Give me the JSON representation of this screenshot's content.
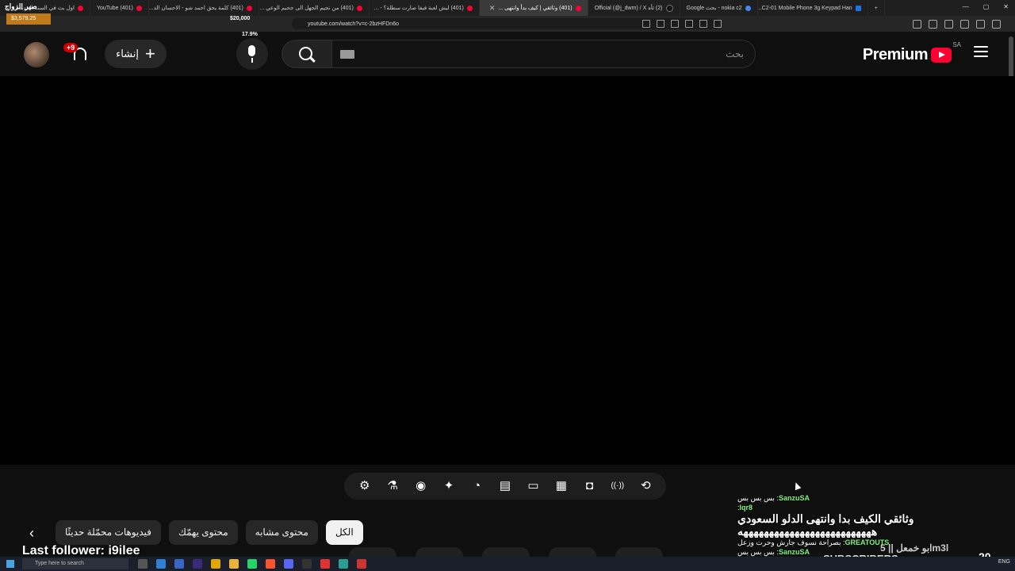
{
  "browser": {
    "tabs": [
      {
        "title": "اول بث في السنة الجديدة - ...",
        "active": false,
        "favicon": "youtube-favicon"
      },
      {
        "title": "(401) YouTube",
        "active": false,
        "favicon": "youtube-favicon"
      },
      {
        "title": "(401) كلمة يحق احمد شو - الاحسان الذ...",
        "active": false,
        "favicon": "youtube-favicon"
      },
      {
        "title": "(401) من نجيم الجهل الى جحيم الوعي ...",
        "active": false,
        "favicon": "youtube-favicon"
      },
      {
        "title": "(401) ليش لعبة فيفا صارت سطلة؟ - ...",
        "active": false,
        "favicon": "youtube-favicon"
      },
      {
        "title": "(401) وثائقي | كيف بدأ وانتهى ...",
        "active": true,
        "favicon": "youtube-favicon"
      },
      {
        "title": "(2) ئأه Official (@j_dwm) / X",
        "active": false,
        "favicon": "x-favicon"
      },
      {
        "title": "nokia c2 - بحث Google",
        "active": false,
        "favicon": "google-favicon"
      },
      {
        "title": "C2-01 Mobile Phone 3g Keypad Han...",
        "active": false,
        "favicon": "site-favicon"
      }
    ],
    "new_tab": "+",
    "url": "youtube.com/watch?v=c-2bzHFDn6o"
  },
  "overlay": {
    "streamer_name": "صير الزواج",
    "price": "$3,579.25",
    "goal": "$20,000",
    "goal_percent": 17.9,
    "goal_percent_label": "17.9%",
    "last_follower": "Last follower: i9ilee",
    "subscribers_label": "SUBSCRIBERS",
    "subscribers_count": "20",
    "overlay_caption": "ابو خمعل || 5m3l"
  },
  "youtube": {
    "logo_text": "Premium",
    "country_code": "SA",
    "search_placeholder": "بحث",
    "create_label": "إنشاء",
    "notification_badge": "+9",
    "toolbar_icons": [
      "gear-icon",
      "flask-icon",
      "camera-icon",
      "sparkle-icon",
      "speedometer-icon",
      "subtitles-icon",
      "aspect-ratio-icon",
      "clapper-icon",
      "cast-screen-icon",
      "broadcast-icon",
      "loop-icon"
    ],
    "chips": [
      {
        "label": "الكل",
        "active": true
      },
      {
        "label": "محتوى مشابه",
        "active": false
      },
      {
        "label": "محتوى يهمّك",
        "active": false
      },
      {
        "label": "فيديوهات محمّلة حديثًا",
        "active": false
      }
    ]
  },
  "chat": {
    "messages": [
      {
        "user": "SanzuSA",
        "text": ": بس بس بس"
      },
      {
        "user": "lqr8",
        "text": ":"
      },
      {
        "user": "",
        "text": "وثائقي الكيف بدا وانتهى الدلو السعودي"
      },
      {
        "user": "",
        "text": "ههههههههههههههههههههههههههه"
      },
      {
        "user": "GREATOUTS",
        "text": ": بصراحة نسوف جارش وحرت وزعل"
      },
      {
        "user": "SanzuSA",
        "text": ": بس بس بس"
      }
    ]
  },
  "taskbar": {
    "search_placeholder": "Type here to search",
    "clock": "ENG"
  }
}
